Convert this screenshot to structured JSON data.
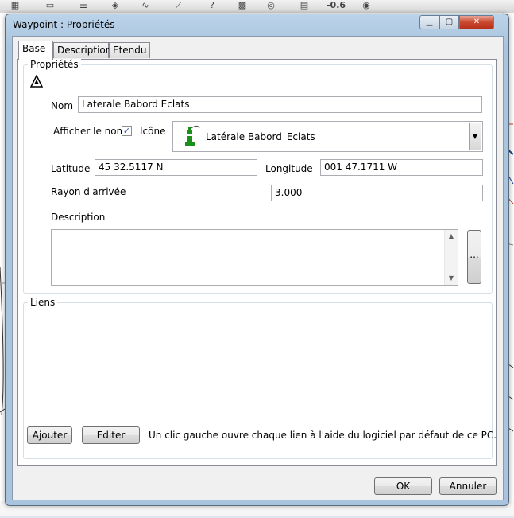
{
  "window": {
    "title": "Waypoint : Propriétés"
  },
  "tabs": [
    {
      "label": "Base",
      "active": true
    },
    {
      "label": "Description",
      "active": false
    },
    {
      "label": "Etendu",
      "active": false
    }
  ],
  "properties": {
    "group_title": "Propriétés",
    "name_label": "Nom",
    "name_value": "Laterale Babord Eclats",
    "show_name_label": "Afficher le nom",
    "show_name_checked": true,
    "icon_label": "Icône",
    "icon_value": "Latérale Babord_Eclats",
    "icon_color": "#1a8f1a",
    "latitude_label": "Latitude",
    "latitude_value": "45 32.5117 N",
    "longitude_label": "Longitude",
    "longitude_value": "001 47.1711 W",
    "arrival_radius_label": "Rayon d'arrivée",
    "arrival_radius_value": "3.000",
    "description_label": "Description",
    "description_value": "",
    "ellipsis_button": "..."
  },
  "links": {
    "group_title": "Liens",
    "add_button": "Ajouter",
    "edit_button": "Editer",
    "hint": "Un clic gauche ouvre chaque lien à l'aide du logiciel par défaut de ce PC."
  },
  "footer": {
    "ok_button": "OK",
    "cancel_button": "Annuler"
  },
  "background": {
    "toolbar_readout": "-0.6"
  }
}
